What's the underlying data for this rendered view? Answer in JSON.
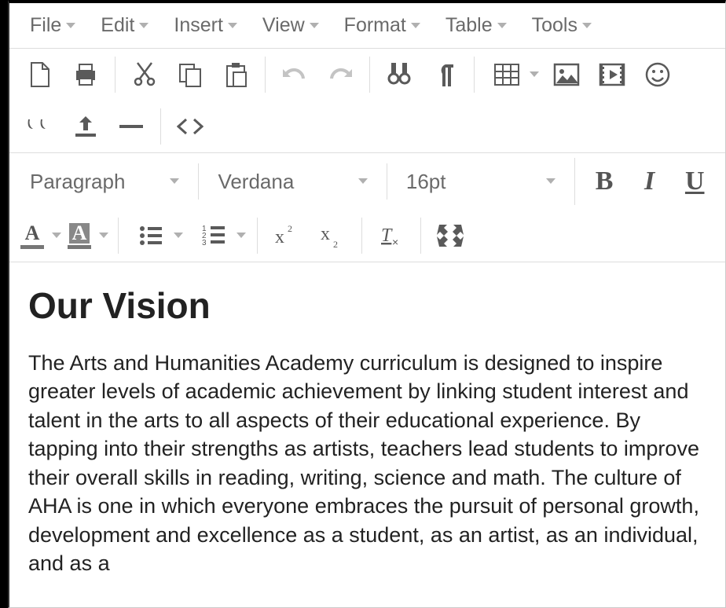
{
  "menubar": {
    "file": "File",
    "edit": "Edit",
    "insert": "Insert",
    "view": "View",
    "format": "Format",
    "table": "Table",
    "tools": "Tools"
  },
  "toolbar_format": {
    "block_format": "Paragraph",
    "font_family": "Verdana",
    "font_size": "16pt",
    "bold": "B",
    "italic": "I",
    "underline": "U",
    "text_color_letter": "A",
    "bg_color_letter": "A"
  },
  "document": {
    "heading": "Our Vision",
    "body": "The Arts and Humanities Academy curriculum is designed to inspire greater levels of academic achievement by linking student interest and talent in the arts to all aspects of their educational experience. By tapping into their strengths as artists, teachers lead students to improve their overall skills in reading, writing, science and math. The culture of AHA is one in which everyone embraces the pursuit of personal growth, development and excellence as a student, as an artist, as an individual, and as a"
  }
}
